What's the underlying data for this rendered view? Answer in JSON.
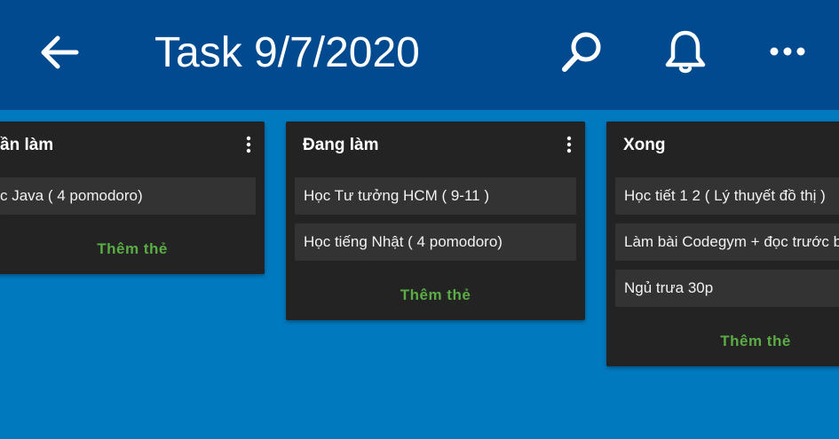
{
  "header": {
    "title": "Task 9/7/2020",
    "back_icon": "arrow-left-icon",
    "search_icon": "search-icon",
    "notification_icon": "bell-icon",
    "more_icon": "more-horizontal-icon"
  },
  "colors": {
    "appbar": "#014a8f",
    "board_background": "#0079bf",
    "list_background": "#232323",
    "card_background": "#333333",
    "add_card_text": "#5aac44"
  },
  "lists": [
    {
      "title": "ần làm",
      "cards": [
        "c Java ( 4 pomodoro)"
      ],
      "add_card_label": "Thêm thẻ"
    },
    {
      "title": "Đang làm",
      "cards": [
        "Học Tư tưởng HCM ( 9-11 )",
        "Học tiếng Nhật ( 4 pomodoro)"
      ],
      "add_card_label": "Thêm thẻ"
    },
    {
      "title": "Xong",
      "cards": [
        "Học tiết 1 2 ( Lý thuyết đồ thị )",
        "Làm bài Codegym + đọc trước b",
        "Ngủ trưa 30p"
      ],
      "add_card_label": "Thêm thẻ"
    }
  ]
}
